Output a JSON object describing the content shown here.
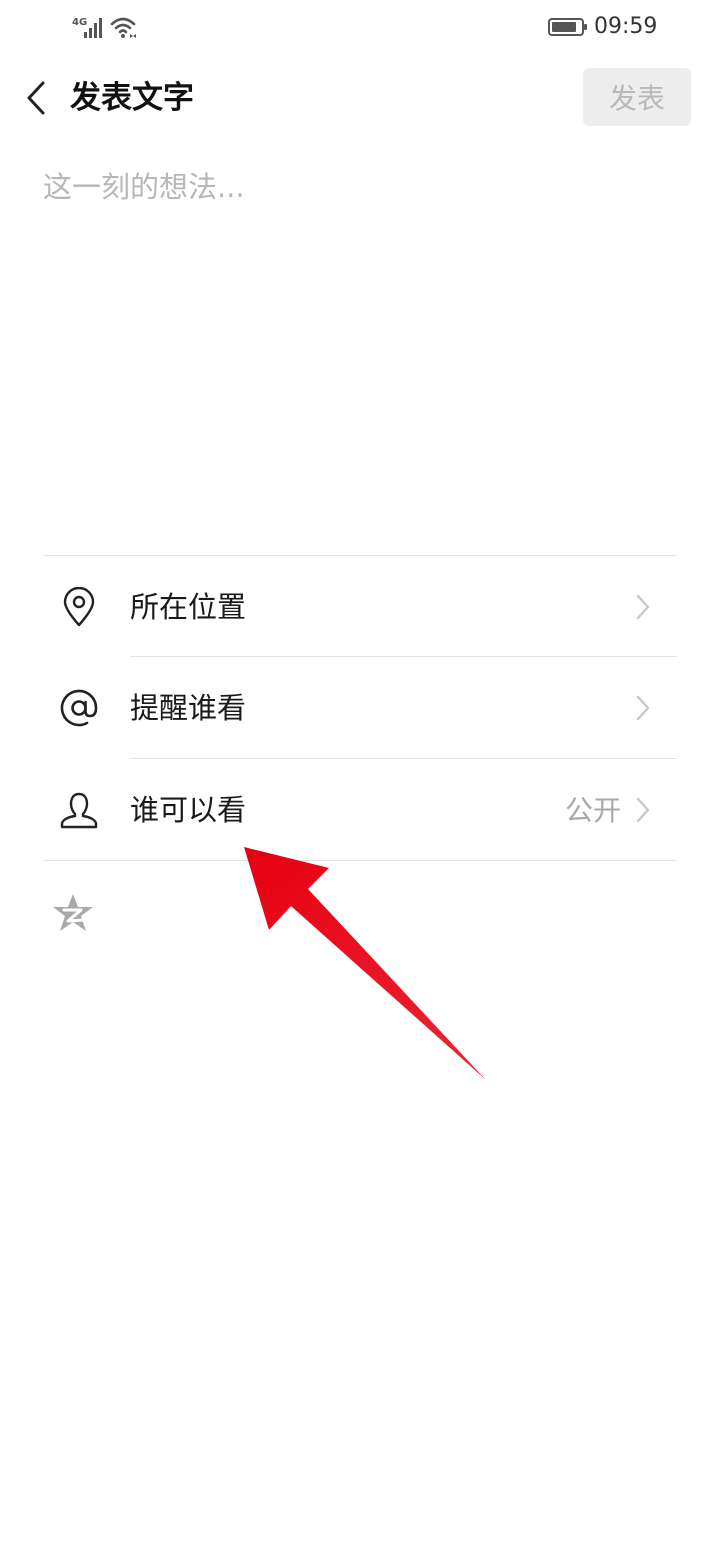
{
  "status_bar": {
    "network": "4G",
    "time": "09:59"
  },
  "header": {
    "title": "发表文字",
    "publish_label": "发表"
  },
  "composer": {
    "placeholder": "这一刻的想法...",
    "value": ""
  },
  "options": [
    {
      "label": "所在位置",
      "value": "",
      "icon": "location-pin-icon"
    },
    {
      "label": "提醒谁看",
      "value": "",
      "icon": "at-sign-icon"
    },
    {
      "label": "谁可以看",
      "value": "公开",
      "icon": "person-icon"
    }
  ],
  "share_target": {
    "icon": "qzone-star-icon"
  },
  "colors": {
    "annotation_arrow": "#e60012",
    "publish_disabled_bg": "#ededed",
    "publish_disabled_text": "#b8b8b8",
    "placeholder": "#b7b7b7",
    "value_text": "#a8a8a8"
  }
}
